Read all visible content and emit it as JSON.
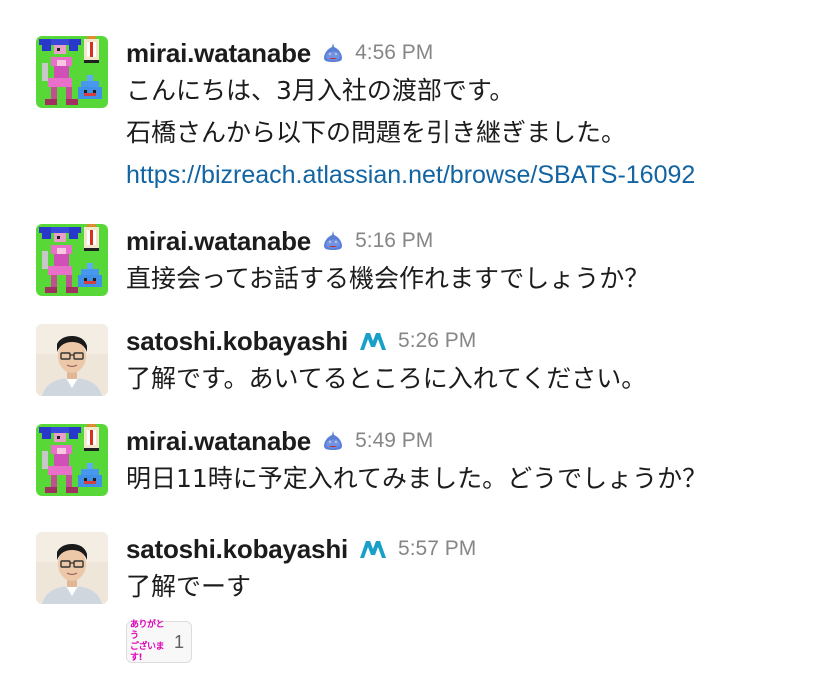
{
  "messages": [
    {
      "user": "mirai.watanabe",
      "avatar": "pixel-art-avatar",
      "badge": "slime-emoji-badge",
      "time": "4:56 PM",
      "lines": [
        "こんにちは、3月入社の渡部です。",
        "石橋さんから以下の問題を引き継ぎました。"
      ],
      "link": "https://bizreach.atlassian.net/browse/SBATS-16092"
    },
    {
      "user": "mirai.watanabe",
      "avatar": "pixel-art-avatar",
      "badge": "slime-emoji-badge",
      "time": "5:16 PM",
      "lines": [
        "直接会ってお話する機会作れますでしょうか？"
      ]
    },
    {
      "user": "satoshi.kobayashi",
      "avatar": "photo-avatar",
      "badge": "m-logo-badge",
      "time": "5:26 PM",
      "lines": [
        "了解です。あいてるところに入れてください。"
      ]
    },
    {
      "user": "mirai.watanabe",
      "avatar": "pixel-art-avatar",
      "badge": "slime-emoji-badge",
      "time": "5:49 PM",
      "lines": [
        "明日11時に予定入れてみました。どうでしょうか？"
      ]
    },
    {
      "user": "satoshi.kobayashi",
      "avatar": "photo-avatar",
      "badge": "m-logo-badge",
      "time": "5:57 PM",
      "lines": [
        "了解でーす"
      ]
    }
  ],
  "reaction": {
    "emoji": "arigatou-gozaimasu-emoji",
    "emoji_text_line1": "ありがとう",
    "emoji_text_line2": "ございます!",
    "count": "1"
  },
  "colors": {
    "link": "#1264a3",
    "timestamp": "#868686",
    "text": "#1d1c1d",
    "badge_teal": "#1aa0c8"
  }
}
